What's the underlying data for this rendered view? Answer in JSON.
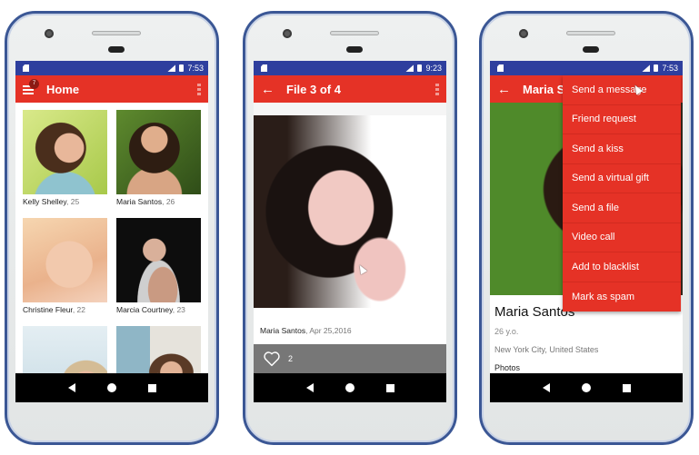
{
  "phones": [
    {
      "status": {
        "time": "7:53"
      },
      "appbar": {
        "title": "Home",
        "nav_icon": "menu-icon",
        "badge_count": "7",
        "overflow_icon": "more-vert-icon"
      },
      "grid": [
        {
          "name": "Kelly Shelley",
          "age": ", 25",
          "photo": "photo-kelly-shelley"
        },
        {
          "name": "Maria Santos",
          "age": ", 26",
          "photo": "photo-maria-santos"
        },
        {
          "name": "Christine Fleur",
          "age": ", 22",
          "photo": "photo-christine-fleur"
        },
        {
          "name": "Marcia Courtney",
          "age": ", 23",
          "photo": "photo-marcia-courtney"
        },
        {
          "name": "",
          "age": "",
          "photo": "photo-blonde-woman"
        },
        {
          "name": "",
          "age": "",
          "photo": "photo-brunette-cup"
        }
      ],
      "navbar": [
        "back",
        "home",
        "recents"
      ]
    },
    {
      "status": {
        "time": "9:23"
      },
      "appbar": {
        "title": "File 3 of 4",
        "nav_icon": "back-arrow-icon",
        "overflow_icon": "more-vert-icon"
      },
      "file": {
        "owner": "Maria Santos",
        "date": ", Apr 25,2016",
        "likes": "2"
      },
      "navbar": [
        "back",
        "home",
        "recents"
      ]
    },
    {
      "status": {
        "time": "7:53"
      },
      "appbar": {
        "title": "Maria Santos",
        "nav_icon": "back-arrow-icon"
      },
      "profile": {
        "name": "Maria Santos",
        "age": "26 y.o.",
        "location": "New York City, United States",
        "section": "Photos"
      },
      "menu": [
        "Send a message",
        "Friend request",
        "Send a kiss",
        "Send a virtual gift",
        "Send a file",
        "Video call",
        "Add to blacklist",
        "Mark as spam"
      ],
      "navbar": [
        "back",
        "home",
        "recents"
      ]
    }
  ],
  "colors": {
    "primary": "#e53226",
    "status_bar": "#2e3f9e",
    "frame": "#3b5795",
    "like_bar": "#777777"
  }
}
